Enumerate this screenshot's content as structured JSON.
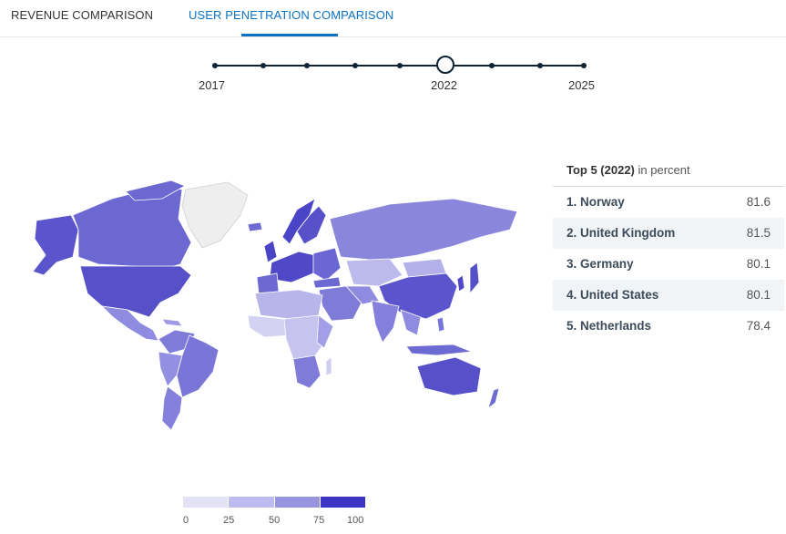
{
  "tabs": [
    {
      "label": "REVENUE COMPARISON",
      "active": false
    },
    {
      "label": "USER PENETRATION COMPARISON",
      "active": true
    }
  ],
  "timeline": {
    "start_label": "2017",
    "selected_label": "2022",
    "end_label": "2025"
  },
  "top5": {
    "title_bold": "Top 5 (2022)",
    "title_rest": " in percent",
    "rows": [
      {
        "rank_label": "1. Norway",
        "value": "81.6"
      },
      {
        "rank_label": "2. United Kingdom",
        "value": "81.5"
      },
      {
        "rank_label": "3. Germany",
        "value": "80.1"
      },
      {
        "rank_label": "4. United States",
        "value": "80.1"
      },
      {
        "rank_label": "5. Netherlands",
        "value": "78.4"
      }
    ]
  },
  "legend": {
    "ticks": [
      "0",
      "25",
      "50",
      "75",
      "100"
    ],
    "colors": [
      "#e3e2f7",
      "#bdbbef",
      "#9794e0",
      "#6e6ad3",
      "#3d36c2"
    ]
  },
  "colors": {
    "accent": "#0b72c3",
    "map_high": "#5a55cc",
    "map_mid": "#8a86dc",
    "map_low": "#bcb9ec",
    "map_nodata": "#ededed"
  }
}
